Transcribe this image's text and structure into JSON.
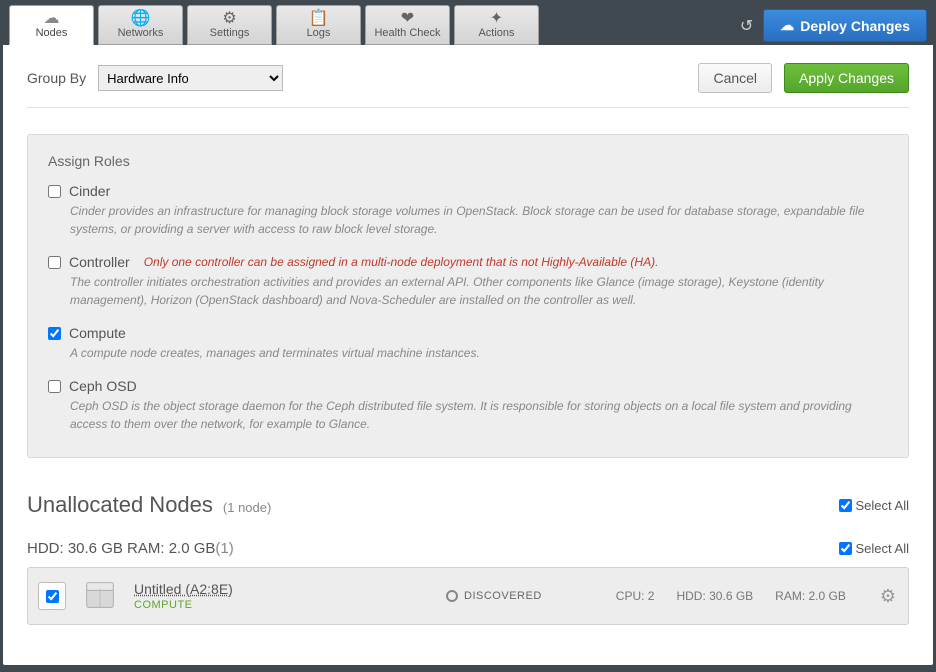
{
  "tabs": [
    {
      "label": "Nodes",
      "icon": "☁"
    },
    {
      "label": "Networks",
      "icon": "🌐"
    },
    {
      "label": "Settings",
      "icon": "⚙"
    },
    {
      "label": "Logs",
      "icon": "📋"
    },
    {
      "label": "Health Check",
      "icon": "❤"
    },
    {
      "label": "Actions",
      "icon": "✦"
    }
  ],
  "deploy_label": "Deploy Changes",
  "toolbar": {
    "group_by_label": "Group By",
    "group_by_value": "Hardware Info",
    "cancel": "Cancel",
    "apply": "Apply Changes"
  },
  "roles": {
    "heading": "Assign Roles",
    "items": [
      {
        "name": "Cinder",
        "checked": false,
        "warn": "",
        "desc": "Cinder provides an infrastructure for managing block storage volumes in OpenStack. Block storage can be used for database storage, expandable file systems, or providing a server with access to raw block level storage."
      },
      {
        "name": "Controller",
        "checked": false,
        "warn": "Only one controller can be assigned in a multi-node deployment that is not Highly-Available (HA).",
        "desc": "The controller initiates orchestration activities and provides an external API. Other components like Glance (image storage), Keystone (identity management), Horizon (OpenStack dashboard) and Nova-Scheduler are installed on the controller as well."
      },
      {
        "name": "Compute",
        "checked": true,
        "warn": "",
        "desc": "A compute node creates, manages and terminates virtual machine instances."
      },
      {
        "name": "Ceph OSD",
        "checked": false,
        "warn": "",
        "desc": "Ceph OSD is the object storage daemon for the Ceph distributed file system. It is responsible for storing objects on a local file system and providing access to them over the network, for example to Glance."
      }
    ]
  },
  "section": {
    "title": "Unallocated Nodes",
    "count": "(1 node)",
    "select_all": "Select All",
    "group_title": "HDD: 30.6 GB   RAM: 2.0 GB ",
    "group_count": "(1)"
  },
  "node": {
    "checked": true,
    "name": "Untitled (A2:8E)",
    "role": "COMPUTE",
    "status": "DISCOVERED",
    "cpu": "CPU: 2",
    "hdd": "HDD: 30.6 GB",
    "ram": "RAM: 2.0 GB"
  }
}
